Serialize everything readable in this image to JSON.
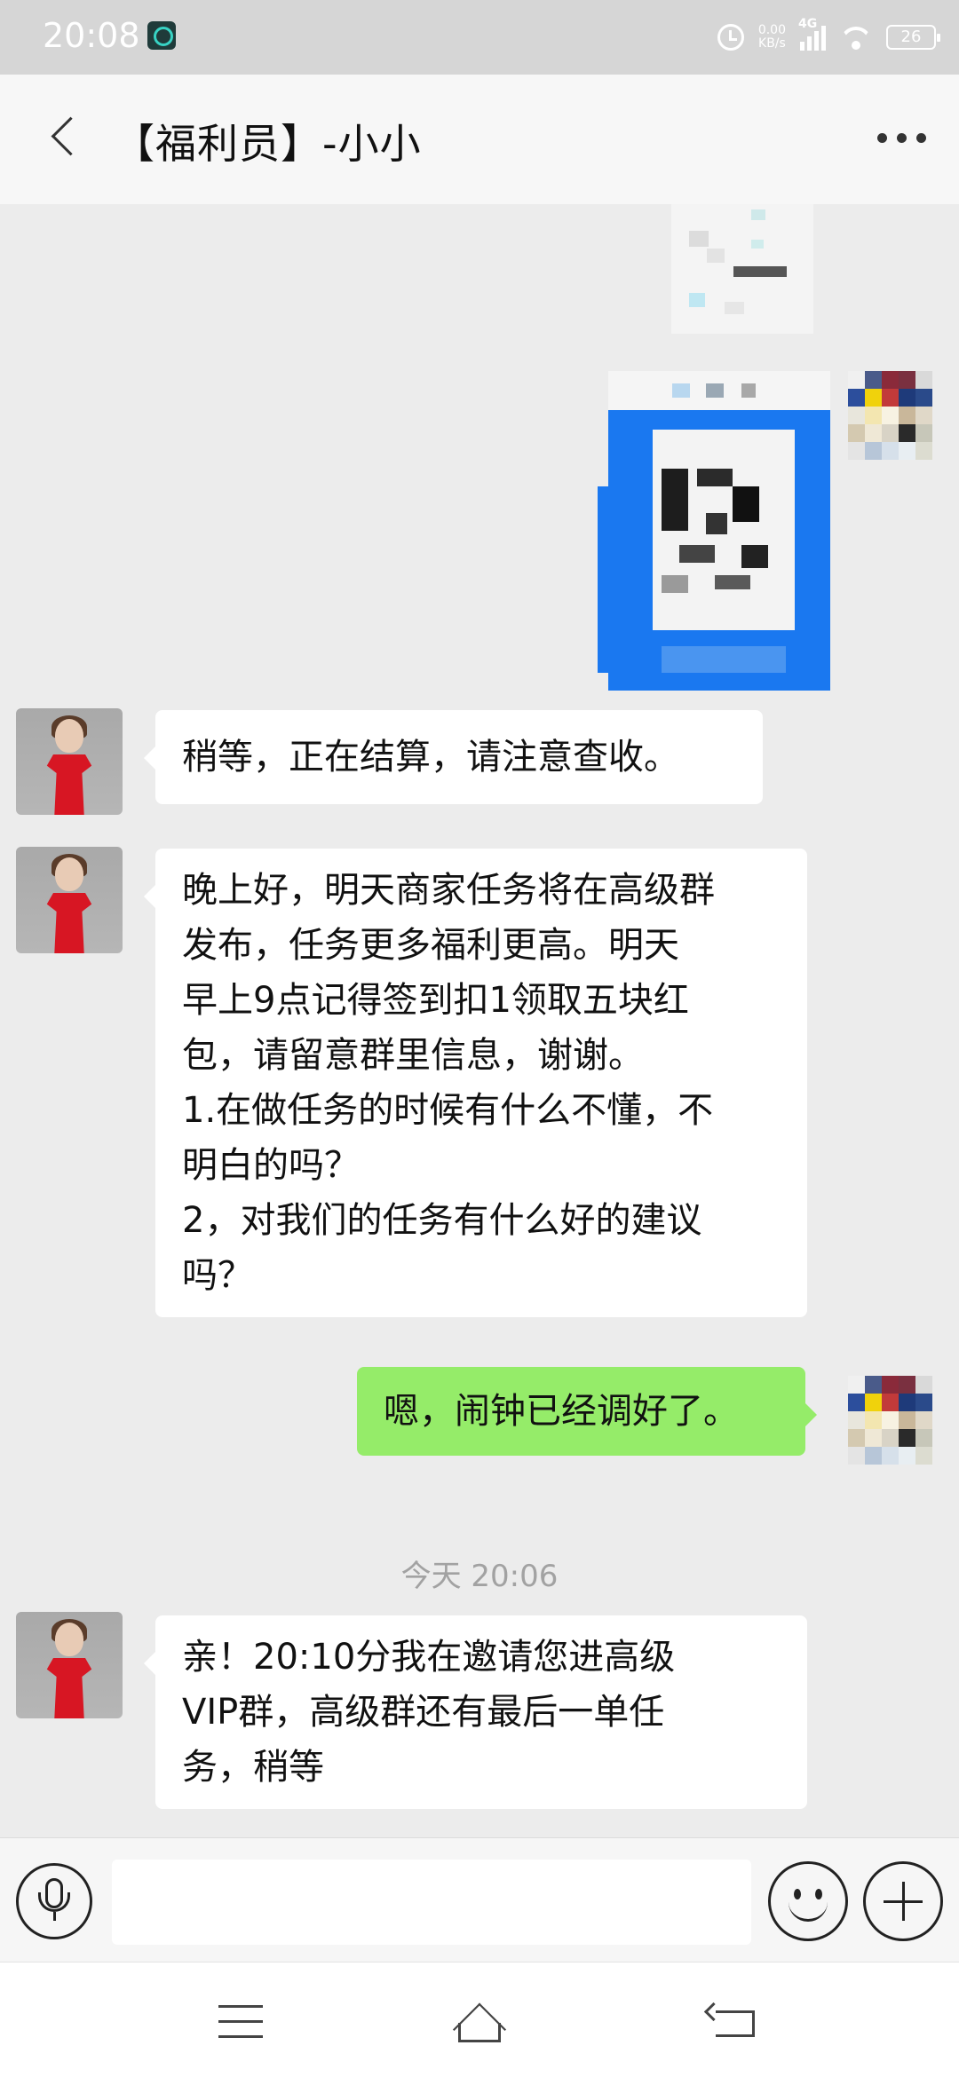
{
  "status_bar": {
    "time": "20:08",
    "speed_value": "0.00",
    "speed_unit": "KB/s",
    "network": "4G",
    "battery": "26"
  },
  "title_bar": {
    "title": "【福利员】-小小"
  },
  "messages": [
    {
      "side": "left",
      "text": "稍等，正在结算，请注意查收。"
    },
    {
      "side": "left",
      "lines": [
        "晚上好，明天商家任务将在高级群",
        "发布，任务更多福利更高。明天",
        "早上9点记得签到扣1领取五块红",
        "包，请留意群里信息，谢谢。",
        "1.在做任务的时候有什么不懂，不",
        "明白的吗？",
        "2，对我们的任务有什么好的建议",
        "吗？"
      ]
    },
    {
      "side": "right",
      "text": "嗯，闹钟已经调好了。"
    },
    {
      "side": "left",
      "lines": [
        "亲！20:10分我在邀请您进高级",
        "VIP群，高级群还有最后一单任",
        "务，稍等"
      ]
    }
  ],
  "timestamp": "今天 20:06",
  "colors": {
    "self_bubble": "#95ec69",
    "other_bubble": "#ffffff",
    "chat_background": "#ececec",
    "qr_blue": "#1a78f0"
  },
  "icons": {
    "back": "back-chevron-icon",
    "more": "more-dots-icon",
    "voice": "microphone-icon",
    "emoji": "emoji-icon",
    "plus": "plus-icon",
    "nav_menu": "menu-icon",
    "nav_home": "home-icon",
    "nav_back": "back-icon"
  }
}
